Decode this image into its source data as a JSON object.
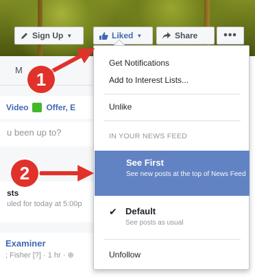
{
  "header": {
    "signup_label": "Sign Up",
    "liked_label": "Liked",
    "share_label": "Share",
    "more_label": "•••"
  },
  "page": {
    "tab_partial": "M",
    "composer_video": "Video",
    "composer_offer": "Offer, E",
    "status_prompt": "u been up to?",
    "scheduled_title": "sts",
    "scheduled_sub": "uled for today at 5:00p",
    "post_author": "Examiner",
    "post_meta": "; Fisher [?] · 1 hr · ⊕"
  },
  "dropdown": {
    "get_notifications": "Get Notifications",
    "add_interest": "Add to Interest Lists...",
    "unlike": "Unlike",
    "section_label": "IN YOUR NEWS FEED",
    "see_first_title": "See First",
    "see_first_desc": "See new posts at the top of News Feed",
    "default_title": "Default",
    "default_desc": "See posts as usual",
    "unfollow": "Unfollow",
    "check_glyph": "✔"
  },
  "annotations": {
    "step1": "1",
    "step2": "2"
  },
  "colors": {
    "accent_blue": "#4267b2",
    "highlight": "#6283c3",
    "annotation_red": "#e0322a"
  },
  "icons": [
    "pencil-icon",
    "thumbs-up-icon",
    "share-arrow-icon",
    "offer-icon",
    "checkmark-icon",
    "arrow-annotation"
  ]
}
